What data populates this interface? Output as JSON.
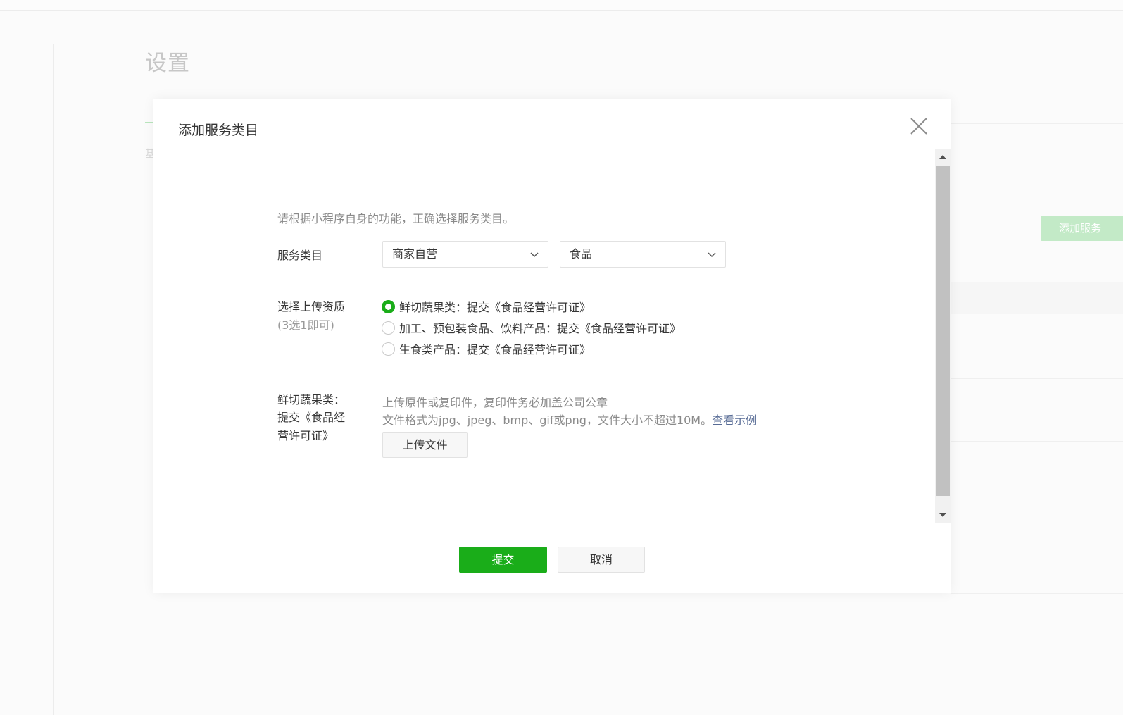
{
  "page": {
    "title": "设置",
    "tab_char": "基",
    "add_button_label": "添加服务"
  },
  "dialog": {
    "title": "添加服务类目",
    "hint": "请根据小程序自身的功能，正确选择服务类目。",
    "category_label": "服务类目",
    "select_primary": "商家自营",
    "select_secondary": "食品",
    "qualification_label": "选择上传资质",
    "qualification_sublabel": "(3选1即可)",
    "options": [
      {
        "label": "鲜切蔬果类：提交《食品经营许可证》",
        "checked": true
      },
      {
        "label": "加工、预包装食品、饮料产品：提交《食品经营许可证》",
        "checked": false
      },
      {
        "label": "生食类产品：提交《食品经营许可证》",
        "checked": false
      }
    ],
    "upload_label_lines": [
      "鲜切蔬果类：",
      "提交《食品经",
      "营许可证》"
    ],
    "upload_hint_1": "上传原件或复印件，复印件务必加盖公司公章",
    "upload_hint_2": "文件格式为jpg、jpeg、bmp、gif或png，文件大小不超过10M。",
    "example_link": "查看示例",
    "upload_button": "上传文件",
    "submit_button": "提交",
    "cancel_button": "取消"
  },
  "colors": {
    "primary": "#1aad19",
    "link": "#576b95",
    "hint_text": "#8a8a8a"
  },
  "icons": [
    "close-icon",
    "chevron-down-icon",
    "scroll-up-arrow-icon",
    "scroll-down-arrow-icon"
  ]
}
